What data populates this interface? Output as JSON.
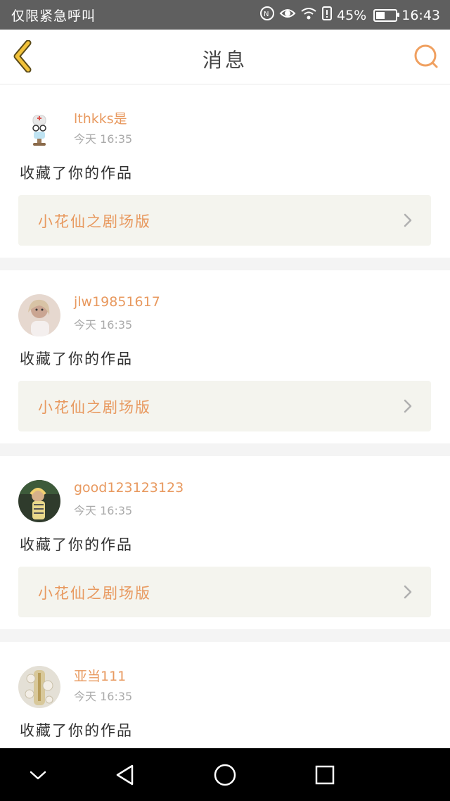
{
  "status_bar": {
    "carrier_text": "仅限紧急呼叫",
    "battery": "45%",
    "time": "16:43",
    "icons": [
      "nfc-icon",
      "eye-icon",
      "wifi-icon",
      "alert-sim-icon",
      "battery-icon"
    ]
  },
  "header": {
    "title": "消息",
    "back_icon": "chevron-left-icon",
    "search_icon": "search-icon",
    "accent_color": "#e8995f"
  },
  "messages": [
    {
      "user": "lthkks是",
      "time": "今天 16:35",
      "action": "收藏了你的作品",
      "work_title": "小花仙之剧场版"
    },
    {
      "user": "jlw19851617",
      "time": "今天 16:35",
      "action": "收藏了你的作品",
      "work_title": "小花仙之剧场版"
    },
    {
      "user": "good123123123",
      "time": "今天 16:35",
      "action": "收藏了你的作品",
      "work_title": "小花仙之剧场版"
    },
    {
      "user": "亚当111",
      "time": "今天 16:35",
      "action": "收藏了你的作品"
    }
  ],
  "nav_bar": {
    "icons": [
      "collapse-chevron-icon",
      "back-triangle-icon",
      "home-circle-icon",
      "recents-square-icon"
    ]
  }
}
